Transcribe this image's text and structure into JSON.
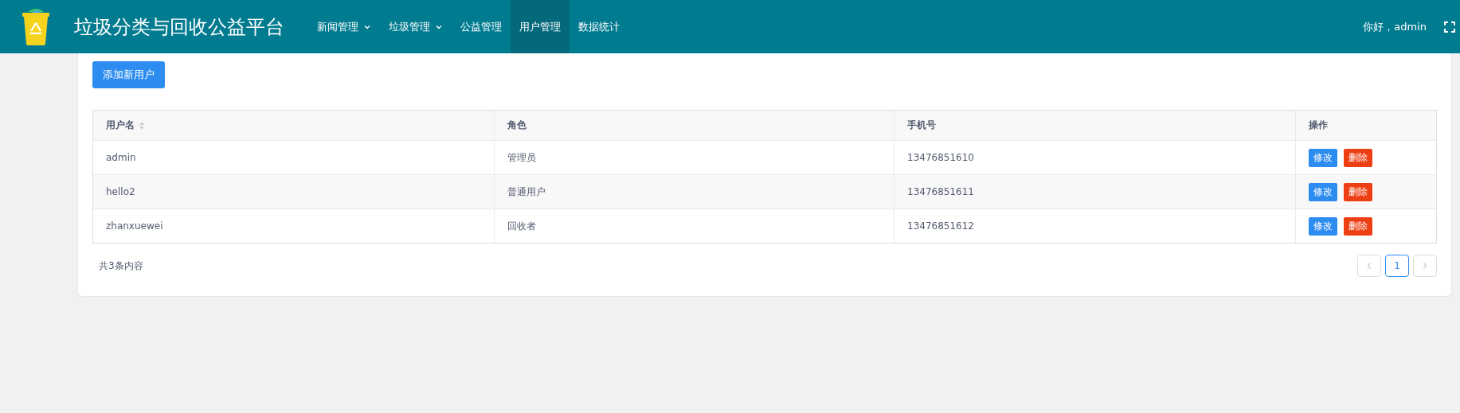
{
  "header": {
    "title": "垃圾分类与回收公益平台",
    "greeting": "你好，admin"
  },
  "nav": [
    {
      "label": "新闻管理",
      "dropdown": true,
      "selected": false
    },
    {
      "label": "垃圾管理",
      "dropdown": true,
      "selected": false
    },
    {
      "label": "公益管理",
      "dropdown": false,
      "selected": false
    },
    {
      "label": "用户管理",
      "dropdown": false,
      "selected": true
    },
    {
      "label": "数据统计",
      "dropdown": false,
      "selected": false
    }
  ],
  "add_button": "添加新用户",
  "table": {
    "columns": [
      {
        "label": "用户名",
        "sortable": true
      },
      {
        "label": "角色",
        "sortable": false
      },
      {
        "label": "手机号",
        "sortable": false
      },
      {
        "label": "操作",
        "sortable": false
      }
    ],
    "rows": [
      {
        "username": "admin",
        "role": "管理员",
        "phone": "13476851610",
        "edit": "修改",
        "delete": "删除"
      },
      {
        "username": "hello2",
        "role": "普通用户",
        "phone": "13476851611",
        "edit": "修改",
        "delete": "删除"
      },
      {
        "username": "zhanxuewei",
        "role": "回收者",
        "phone": "13476851612",
        "edit": "修改",
        "delete": "删除"
      }
    ]
  },
  "footer": {
    "total": "共3条内容",
    "pages": [
      {
        "label": "1",
        "selected": true
      }
    ]
  }
}
